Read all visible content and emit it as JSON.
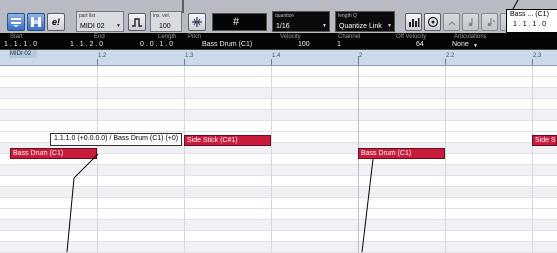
{
  "toolbar": {
    "buttons": [
      "show-info",
      "show-part",
      "e!",
      "step-input",
      "mouse-note-position",
      "note-length"
    ],
    "e_label": "e!",
    "part_list": {
      "label": "part list",
      "value": "MIDI 02"
    },
    "ins_vel": {
      "label": "ins. vel.",
      "value": "100"
    },
    "quantize": {
      "label": "quantize",
      "value": "1/16"
    },
    "length": {
      "label": "length Q",
      "value": "Quantize Link"
    },
    "hash_label": "#"
  },
  "callout_top": {
    "line1": "Bass ... (C1)",
    "line2": "1 . 1 . 1 . 0"
  },
  "infobar": {
    "headers": [
      "Start",
      "End",
      "Length",
      "Pitch",
      "Velocity",
      "Channel",
      "Off Velocity",
      "Articulations"
    ],
    "values": [
      "1 . 1 . 1 . 0",
      "1 . 1 . 2 . 0",
      "0 . 0 . 1 . 0",
      "Bass Drum (C1)",
      "100",
      "1",
      "64",
      "None"
    ]
  },
  "ruler": {
    "part_name": "MIDI 02",
    "markers": [
      "1.2",
      "1.3",
      "1.4",
      "2",
      "2.2",
      "2.3"
    ]
  },
  "tooltip": "1.1.1.0 (+0.0.0.0) / Bass Drum (C1) (+0)",
  "notes": [
    {
      "label": "Bass Drum (C1)"
    },
    {
      "label": "Side Stick (C#1)"
    },
    {
      "label": "Bass Drum (C1)"
    },
    {
      "label": "Side St"
    }
  ]
}
